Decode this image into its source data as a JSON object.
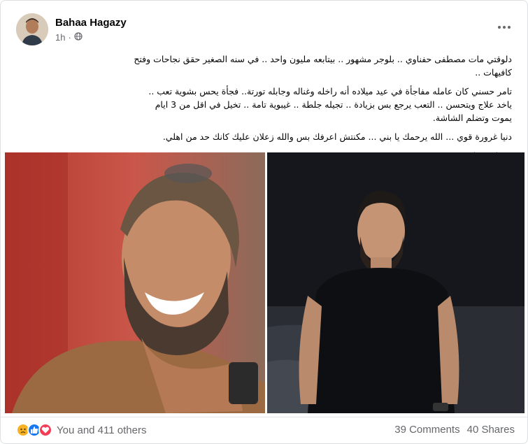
{
  "post": {
    "author_name": "Bahaa Hagazy",
    "time_ago": "1h",
    "privacy_icon": "globe-icon",
    "more_icon": "more-options-icon",
    "paragraphs": [
      "دلوقتي مات مصطفى حفناوي .. بلوجر مشهور .. بيتابعه مليون واحد .. في سنه الصغير حقق نجاحات وفتح كافيهات ..",
      "تامر حسني كان عامله مفاجأة في عيد ميلاده أنه راخله وغناله وجابله تورتة.. فجأة يحس بشوية تعب .. ياخد علاج ويتحسن .. التعب يرجع بس بزيادة .. تجيله جلطة .. غيبوية تامة .. تخيل في اقل من 3 ايام يموت وتضلم الشاشة.",
      "دنيا غرورة قوي ... الله يرحمك يا بني ... مكنتش اعرفك بس والله زعلان عليك كانك حد من اهلي."
    ],
    "hashtag": "#بهاء_حجازي"
  },
  "photos": {
    "left_alt": "smiling-man-photo",
    "right_alt": "man-by-sea-at-night-photo"
  },
  "footer": {
    "reaction_icons": [
      "sad-reaction-icon",
      "like-reaction-icon",
      "love-reaction-icon"
    ],
    "reactions_text": "You and 411 others",
    "comments": "39 Comments",
    "shares": "40 Shares"
  },
  "colors": {
    "secondary_text": "#65676b",
    "hashtag": "#385898",
    "like_blue": "#1877f2",
    "love_red": "#f33e58",
    "sad_yellow": "#f7b125"
  }
}
